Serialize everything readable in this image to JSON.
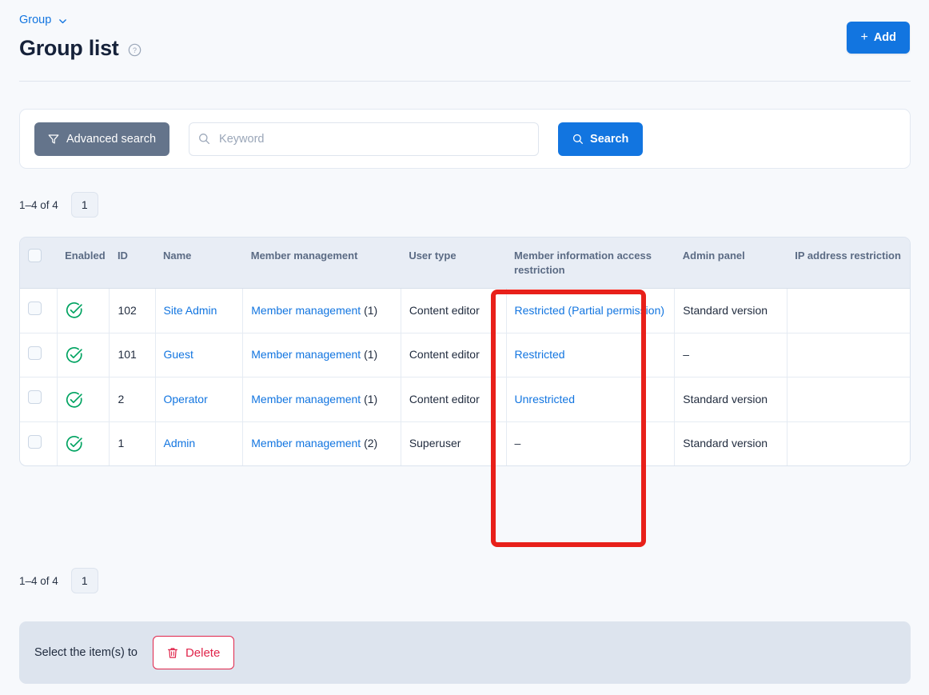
{
  "header": {
    "breadcrumb": "Group",
    "breadcrumb_icon": "chevron-down-icon",
    "title": "Group list",
    "help_icon": "help-circle-icon",
    "add_label": "Add",
    "add_plus": "+"
  },
  "search": {
    "advanced_label": "Advanced search",
    "advanced_icon": "filter-funnel-icon",
    "keyword_placeholder": "Keyword",
    "keyword_value": "",
    "keyword_icon": "search-icon",
    "search_label": "Search",
    "search_icon": "search-icon"
  },
  "pagination": {
    "range": "1–4 of 4",
    "current_page": "1"
  },
  "table": {
    "columns": [
      "",
      "Enabled",
      "ID",
      "Name",
      "Member management",
      "User type",
      "Member information access restriction",
      "Admin panel",
      "IP address restriction"
    ],
    "rows": [
      {
        "enabled_icon": "check-circle-icon",
        "id": "102",
        "name": "Site Admin",
        "member_management": "Member management",
        "member_management_count": "(1)",
        "user_type": "Content editor",
        "member_info_access": "Restricted (Partial permission)",
        "admin_panel": "Standard version",
        "ip_restriction": ""
      },
      {
        "enabled_icon": "check-circle-icon",
        "id": "101",
        "name": "Guest",
        "member_management": "Member management",
        "member_management_count": "(1)",
        "user_type": "Content editor",
        "member_info_access": "Restricted",
        "admin_panel": "–",
        "ip_restriction": ""
      },
      {
        "enabled_icon": "check-circle-icon",
        "id": "2",
        "name": "Operator",
        "member_management": "Member management",
        "member_management_count": "(1)",
        "user_type": "Content editor",
        "member_info_access": "Unrestricted",
        "admin_panel": "Standard version",
        "ip_restriction": ""
      },
      {
        "enabled_icon": "check-circle-icon",
        "id": "1",
        "name": "Admin",
        "member_management": "Member management",
        "member_management_count": "(2)",
        "user_type": "Superuser",
        "member_info_access": "–",
        "admin_panel": "Standard version",
        "ip_restriction": ""
      }
    ]
  },
  "action_bar": {
    "label": "Select the item(s) to",
    "delete_label": "Delete",
    "delete_icon": "trash-icon"
  },
  "annotation": {
    "shape": "rectangle-highlight",
    "target_column": "Member information access restriction",
    "color": "#e8201a"
  },
  "colors": {
    "accent": "#1275e0",
    "success": "#00a361",
    "danger": "#e0244a",
    "annotation": "#e8201a",
    "page_bg": "#f7f9fc",
    "header_bg": "#e8edf5"
  }
}
